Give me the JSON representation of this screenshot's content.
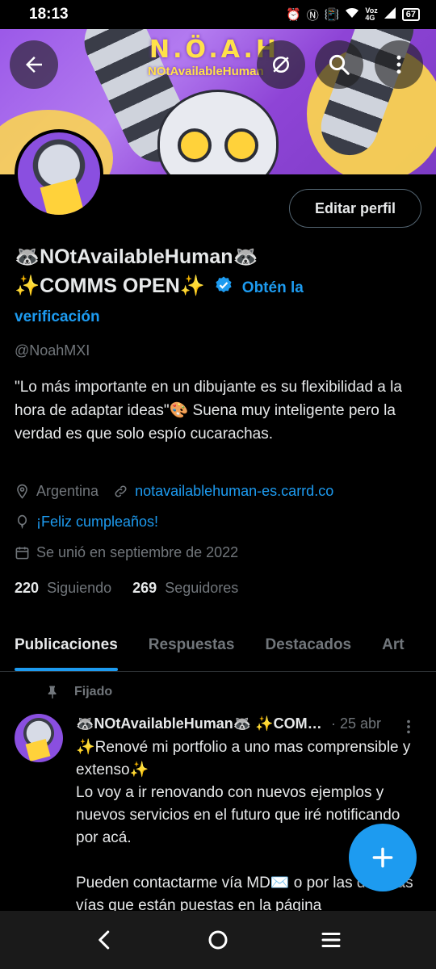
{
  "status_bar": {
    "time": "18:13",
    "network_top": "Voz",
    "network_bottom": "4G",
    "signal_label": "4G",
    "battery": "67"
  },
  "banner": {
    "logo_title": "N.Ö.A.H",
    "logo_subtitle": "NOtAvailableHuman"
  },
  "header_buttons": {
    "back_icon": "arrow-left-icon",
    "incognito_icon": "incognito-icon",
    "search_icon": "search-icon",
    "more_icon": "more-vertical-icon"
  },
  "profile": {
    "edit_button_label": "Editar perfil",
    "display_name_line1": "🦝NOtAvailableHuman🦝",
    "display_name_line2": "✨COMMS OPEN✨",
    "verify_cta_part1": "Obtén la",
    "verify_cta_part2": "verificación",
    "handle": "@NoahMXI",
    "bio": "\"Lo más importante en un dibujante es su flexibilidad a la hora de adaptar ideas\"🎨 Suena muy inteligente pero la verdad es que solo espío cucarachas.",
    "location": "Argentina",
    "website": "notavailablehuman-es.carrd.co",
    "birthday_text": "¡Feliz cumpleaños!",
    "joined": "Se unió en septiembre de 2022",
    "following_count": "220",
    "following_label": "Siguiendo",
    "followers_count": "269",
    "followers_label": "Seguidores"
  },
  "tabs": [
    {
      "label": "Publicaciones",
      "active": true
    },
    {
      "label": "Respuestas",
      "active": false
    },
    {
      "label": "Destacados",
      "active": false
    },
    {
      "label": "Art",
      "active": false
    }
  ],
  "pinned_post": {
    "pinned_label": "Fijado",
    "author_name": "🦝NOtAvailableHuman🦝 ✨COMMS OPEN✨",
    "date": "· 25 abr",
    "body": "✨Renové mi portfolio a uno mas comprensible y extenso✨\nLo voy a ir renovando con nuevos ejemplos y nuevos servicios en el futuro que iré notificando por acá.\n\nPueden contactarme vía MD✉️ o por las distintas vías que están puestas en la página"
  },
  "colors": {
    "accent": "#1d9bf0",
    "background": "#000000",
    "text_primary": "#e7e9ea",
    "text_secondary": "#71767b",
    "banner_purple": "#9b59e8",
    "banner_yellow": "#ffd94a"
  }
}
